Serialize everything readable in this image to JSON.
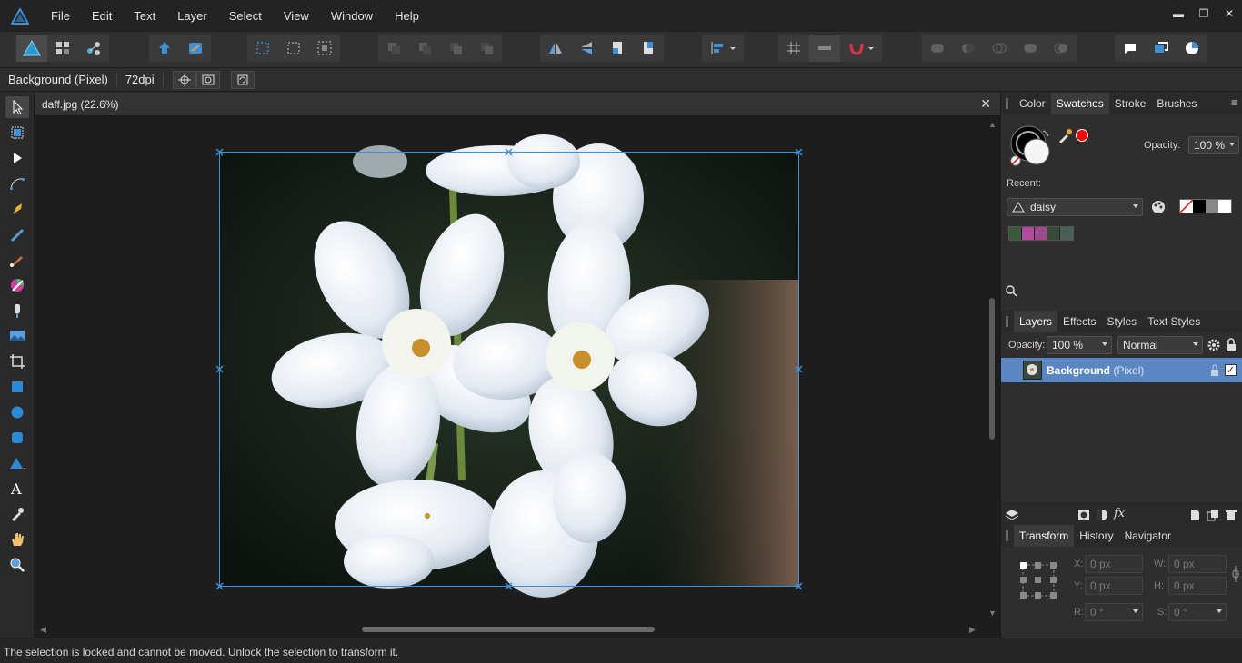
{
  "app": {
    "name": "Affinity Photo",
    "accent": "#3d8fd6"
  },
  "menu": [
    "File",
    "Edit",
    "Text",
    "Layer",
    "Select",
    "View",
    "Window",
    "Help"
  ],
  "context_bar": {
    "layer_label": "Background (Pixel)",
    "dpi": "72dpi"
  },
  "document": {
    "tab_title": "daff.jpg (22.6%)",
    "image_subject": "white daffodil flowers"
  },
  "color_panel": {
    "tabs": [
      "Color",
      "Swatches",
      "Stroke",
      "Brushes"
    ],
    "active_tab": "Swatches",
    "opacity_label": "Opacity:",
    "opacity_value": "100 %",
    "recent_label": "Recent:",
    "palette_name": "daisy",
    "recent_swatches": [
      "#3b5a3b",
      "#b24aa0",
      "#9c4c8a",
      "#3a4a3a",
      "#4b5e55"
    ],
    "basic_swatches": [
      "#ffffff",
      "#000000",
      "#888888",
      "#ffffff"
    ],
    "fill_color": "#ffffff",
    "picked_color": "#ff0000"
  },
  "layers_panel": {
    "tabs": [
      "Layers",
      "Effects",
      "Styles",
      "Text Styles"
    ],
    "active_tab": "Layers",
    "opacity_label": "Opacity:",
    "opacity_value": "100 %",
    "blend_mode": "Normal",
    "layers": [
      {
        "name": "Background",
        "kind": "(Pixel)",
        "visible": true,
        "locked": true
      }
    ]
  },
  "transform_panel": {
    "tabs": [
      "Transform",
      "History",
      "Navigator"
    ],
    "active_tab": "Transform",
    "x_label": "X:",
    "x_value": "0 px",
    "y_label": "Y:",
    "y_value": "0 px",
    "w_label": "W:",
    "w_value": "0 px",
    "h_label": "H:",
    "h_value": "0 px",
    "r_label": "R:",
    "r_value": "0 °",
    "s_label": "S:",
    "s_value": "0 °"
  },
  "status": {
    "message": "The selection is locked and cannot be moved. Unlock the selection to transform it."
  }
}
